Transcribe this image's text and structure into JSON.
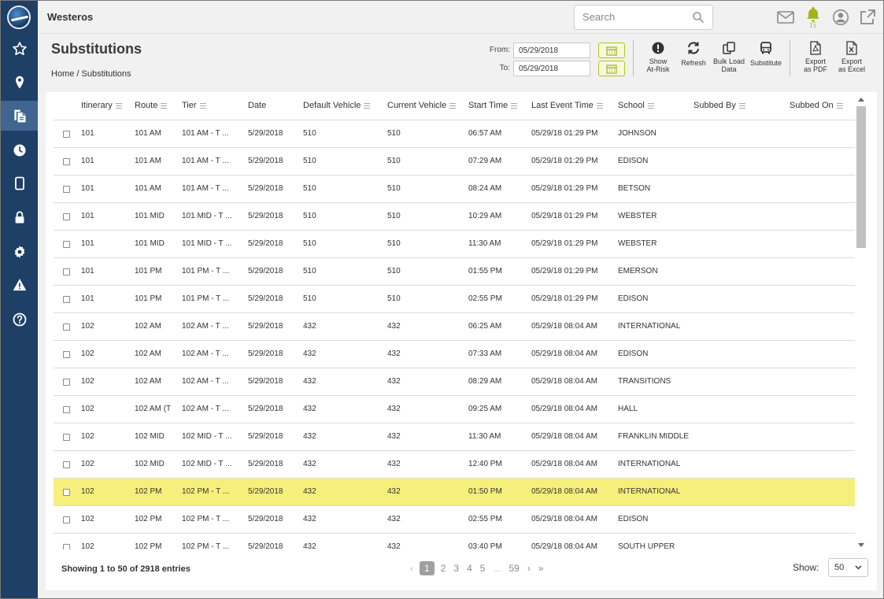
{
  "app": {
    "title": "Westeros"
  },
  "search": {
    "placeholder": "Search"
  },
  "notifications": {
    "count": "15"
  },
  "colors": {
    "sidebar": "#1e3f66",
    "accent": "#a4b21a",
    "highlight_row": "#f7ef7b"
  },
  "icons": {
    "sidebar": [
      "star-icon",
      "map-pin-icon",
      "substitutions-icon",
      "clock-icon",
      "tablet-icon",
      "lock-icon",
      "gear-icon",
      "warning-icon",
      "help-icon"
    ],
    "topbar": [
      "mail-icon",
      "bell-icon",
      "user-icon",
      "external-link-icon"
    ]
  },
  "page": {
    "title": "Substitutions",
    "breadcrumb": "Home / Substitutions"
  },
  "date_range": {
    "from_label": "From:",
    "from_value": "05/29/2018",
    "to_label": "To:",
    "to_value": "05/29/2018"
  },
  "toolbar": {
    "show_at_risk": [
      "Show",
      "At-Risk"
    ],
    "refresh": "Refresh",
    "bulk_load": [
      "Bulk Load",
      "Data"
    ],
    "substitute": "Substitute",
    "export_pdf": [
      "Export",
      "as PDF"
    ],
    "export_excel": [
      "Export",
      "as Excel"
    ]
  },
  "table": {
    "columns": [
      "Itinerary",
      "Route",
      "Tier",
      "Date",
      "Default Vehicle",
      "Current Vehicle",
      "Start Time",
      "Last Event Time",
      "School",
      "Subbed By",
      "Subbed On"
    ],
    "rows": [
      [
        "101",
        "101 AM",
        "101 AM - T ...",
        "5/29/2018",
        "510",
        "510",
        "06:57 AM",
        "05/29/18 01:29 PM",
        "JOHNSON",
        "",
        ""
      ],
      [
        "101",
        "101 AM",
        "101 AM - T ...",
        "5/29/2018",
        "510",
        "510",
        "07:29 AM",
        "05/29/18 01:29 PM",
        "EDISON",
        "",
        ""
      ],
      [
        "101",
        "101 AM",
        "101 AM - T ...",
        "5/29/2018",
        "510",
        "510",
        "08:24 AM",
        "05/29/18 01:29 PM",
        "BETSON",
        "",
        ""
      ],
      [
        "101",
        "101 MID",
        "101 MID - T ...",
        "5/29/2018",
        "510",
        "510",
        "10:29 AM",
        "05/29/18 01:29 PM",
        "WEBSTER",
        "",
        ""
      ],
      [
        "101",
        "101 MID",
        "101 MID - T ...",
        "5/29/2018",
        "510",
        "510",
        "11:30 AM",
        "05/29/18 01:29 PM",
        "WEBSTER",
        "",
        ""
      ],
      [
        "101",
        "101 PM",
        "101 PM - T ...",
        "5/29/2018",
        "510",
        "510",
        "01:55 PM",
        "05/29/18 01:29 PM",
        "EMERSON",
        "",
        ""
      ],
      [
        "101",
        "101 PM",
        "101 PM - T ...",
        "5/29/2018",
        "510",
        "510",
        "02:55 PM",
        "05/29/18 01:29 PM",
        "EDISON",
        "",
        ""
      ],
      [
        "102",
        "102 AM",
        "102 AM - T ...",
        "5/29/2018",
        "432",
        "432",
        "06:25 AM",
        "05/29/18 08:04 AM",
        "INTERNATIONAL",
        "",
        ""
      ],
      [
        "102",
        "102 AM",
        "102 AM - T ...",
        "5/29/2018",
        "432",
        "432",
        "07:33 AM",
        "05/29/18 08:04 AM",
        "EDISON",
        "",
        ""
      ],
      [
        "102",
        "102 AM",
        "102 AM - T ...",
        "5/29/2018",
        "432",
        "432",
        "08:29 AM",
        "05/29/18 08:04 AM",
        "TRANSITIONS",
        "",
        ""
      ],
      [
        "102",
        "102 AM (T",
        "102 AM - T ...",
        "5/29/2018",
        "432",
        "432",
        "09:25 AM",
        "05/29/18 08:04 AM",
        "HALL",
        "",
        ""
      ],
      [
        "102",
        "102 MID",
        "102 MID - T ...",
        "5/29/2018",
        "432",
        "432",
        "11:30 AM",
        "05/29/18 08:04 AM",
        "FRANKLIN MIDDLE",
        "",
        ""
      ],
      [
        "102",
        "102 MID",
        "102 MID - T ...",
        "5/29/2018",
        "432",
        "432",
        "12:40 PM",
        "05/29/18 08:04 AM",
        "INTERNATIONAL",
        "",
        ""
      ],
      [
        "102",
        "102 PM",
        "102 PM - T ...",
        "5/29/2018",
        "432",
        "432",
        "01:50 PM",
        "05/29/18 08:04 AM",
        "INTERNATIONAL",
        "",
        ""
      ],
      [
        "102",
        "102 PM",
        "102 PM - T ...",
        "5/29/2018",
        "432",
        "432",
        "02:55 PM",
        "05/29/18 08:04 AM",
        "EDISON",
        "",
        ""
      ],
      [
        "102",
        "102 PM",
        "102 PM - T ...",
        "5/29/2018",
        "432",
        "432",
        "03:40 PM",
        "05/29/18 08:04 AM",
        "SOUTH UPPER",
        "",
        ""
      ]
    ],
    "highlighted_row": 13
  },
  "footer": {
    "info": "Showing 1 to 50 of 2918 entries",
    "pages": [
      "1",
      "2",
      "3",
      "4",
      "5",
      "...",
      "59"
    ],
    "current_page": "1",
    "prev": "‹",
    "next": "›",
    "last": "»",
    "show_label": "Show:",
    "page_size": "50"
  }
}
